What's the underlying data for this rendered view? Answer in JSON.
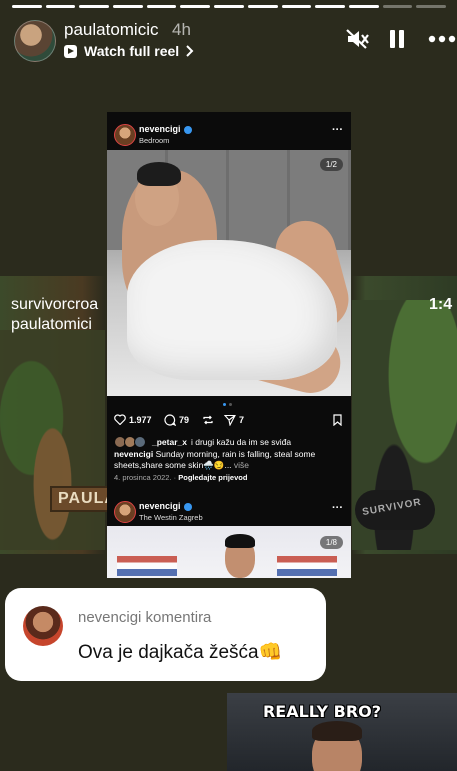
{
  "progress": {
    "total": 13,
    "completed": 11
  },
  "header": {
    "username": "paulatomicic",
    "time_ago": "4h",
    "watch_label": "Watch full reel",
    "icons": [
      "mute-icon",
      "pause-icon",
      "more-icon"
    ]
  },
  "background": {
    "overlay_left": "survivorcroa\npaulatomici",
    "overlay_right": "1:4",
    "sign": "PAULA T",
    "bag": "SURVIVOR"
  },
  "post": {
    "username": "nevencigi",
    "location": "Bedroom",
    "counter": "1/2",
    "likes": "1.977",
    "comments": "79",
    "shares": "7",
    "liked_by_user": "_petar_x",
    "liked_by_rest": "i drugi kažu da im se sviđa",
    "caption_user": "nevencigi",
    "caption_text": "Sunday morning, rain is falling, steal some sheets,share some skin🌧️😏...",
    "more": "više",
    "date": "4. prosinca 2022.",
    "translate": "Pogledajte prijevod"
  },
  "post2": {
    "username": "nevencigi",
    "location": "The Westin Zagreb",
    "counter": "1/8"
  },
  "comment_sticker": {
    "title": "nevencigi komentira",
    "text": "Ova je dajkača žešća👊"
  },
  "meme": {
    "text": "REALLY BRO?"
  }
}
